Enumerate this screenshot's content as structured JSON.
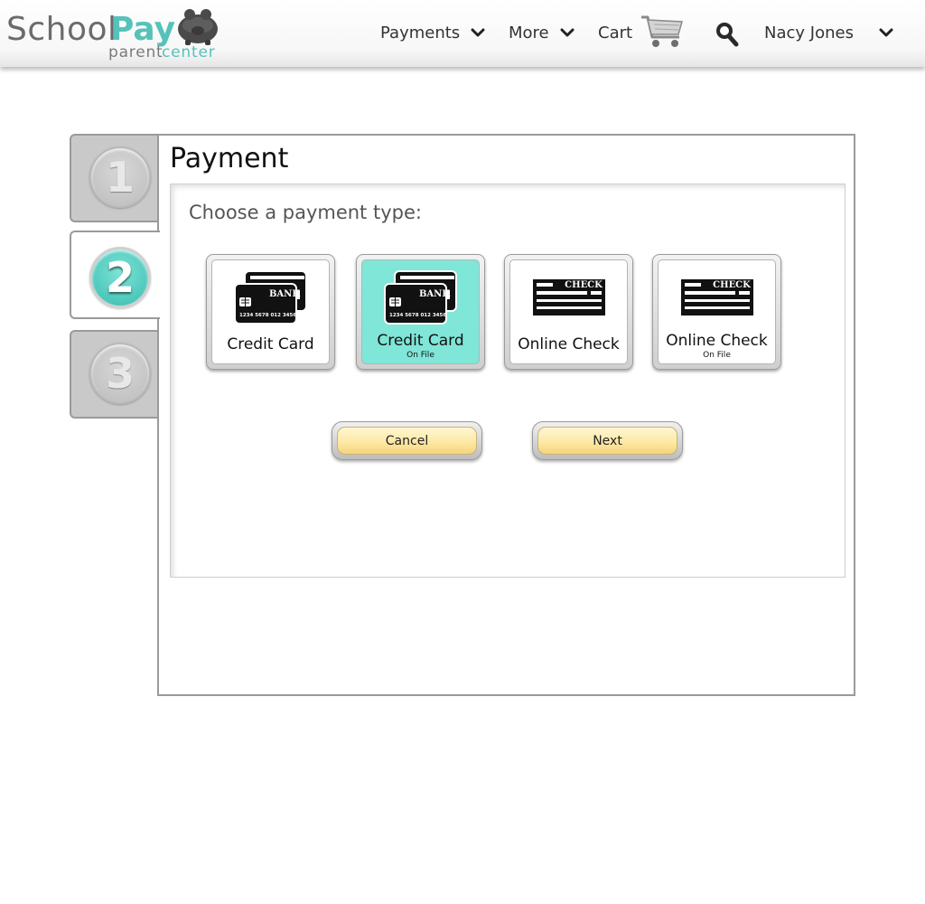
{
  "brand": {
    "school": "School",
    "pay": "Pay",
    "parent": "parent",
    "center": "center",
    "accent_color": "#56c2b9",
    "logo_icon": "piggy-bank-icon"
  },
  "nav": {
    "payments_label": "Payments",
    "more_label": "More",
    "cart_label": "Cart",
    "user_name": "Nacy Jones",
    "cart_icon": "shopping-cart-icon",
    "search_icon": "search-icon"
  },
  "steps": [
    {
      "number": "1",
      "state": "inactive"
    },
    {
      "number": "2",
      "state": "active"
    },
    {
      "number": "3",
      "state": "inactive"
    }
  ],
  "panel": {
    "title": "Payment",
    "prompt": "Choose a payment type:"
  },
  "payment_types": [
    {
      "label": "Credit Card",
      "sublabel": "",
      "icon": "bank-cards-icon",
      "selected": false,
      "card_text": "BANK",
      "card_numbers": "1234 5678 012 3456"
    },
    {
      "label": "Credit Card",
      "sublabel": "On File",
      "icon": "bank-cards-icon",
      "selected": true,
      "card_text": "BANK",
      "card_numbers": "1234 5678 012 3456"
    },
    {
      "label": "Online Check",
      "sublabel": "",
      "icon": "check-icon",
      "selected": false,
      "check_text": "CHECK"
    },
    {
      "label": "Online Check",
      "sublabel": "On File",
      "icon": "check-icon",
      "selected": false,
      "check_text": "CHECK"
    }
  ],
  "buttons": {
    "cancel": "Cancel",
    "next": "Next"
  },
  "colors": {
    "selected_bg": "#80e6d7",
    "button_face": "#fde9a6",
    "step_active": "#4cc8bb",
    "step_inactive": "#c9c9c9"
  }
}
